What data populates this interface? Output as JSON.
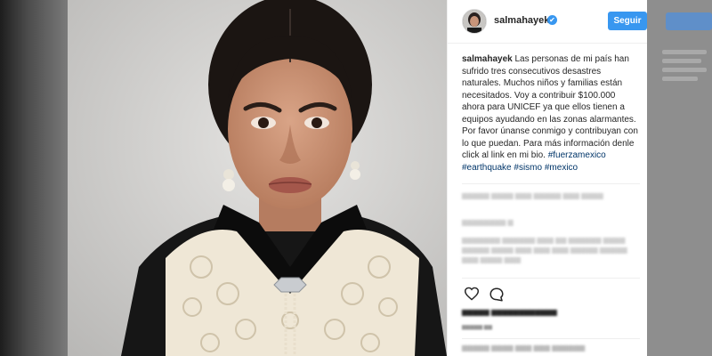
{
  "post": {
    "username": "salmahayek",
    "verified_mark": "✔",
    "follow_label": "Seguir",
    "caption_text": "Las personas de mi país han sufrido tres consecutivos desastres naturales. Muchos niños y familias están necesitados. Voy a contribuir $100.000 ahora para UNICEF ya que ellos tienen a equipos ayudando en las zonas alarmantes. Por favor únanse conmigo y contribuyan con lo que puedan. Para más información denle click al link en mi bio.",
    "hashtags": [
      "#fuerzamexico",
      "#earthquake",
      "#sismo",
      "#mexico"
    ]
  },
  "accent_color": "#3897f0",
  "icons": [
    "verified-icon",
    "heart-icon",
    "comment-icon"
  ]
}
